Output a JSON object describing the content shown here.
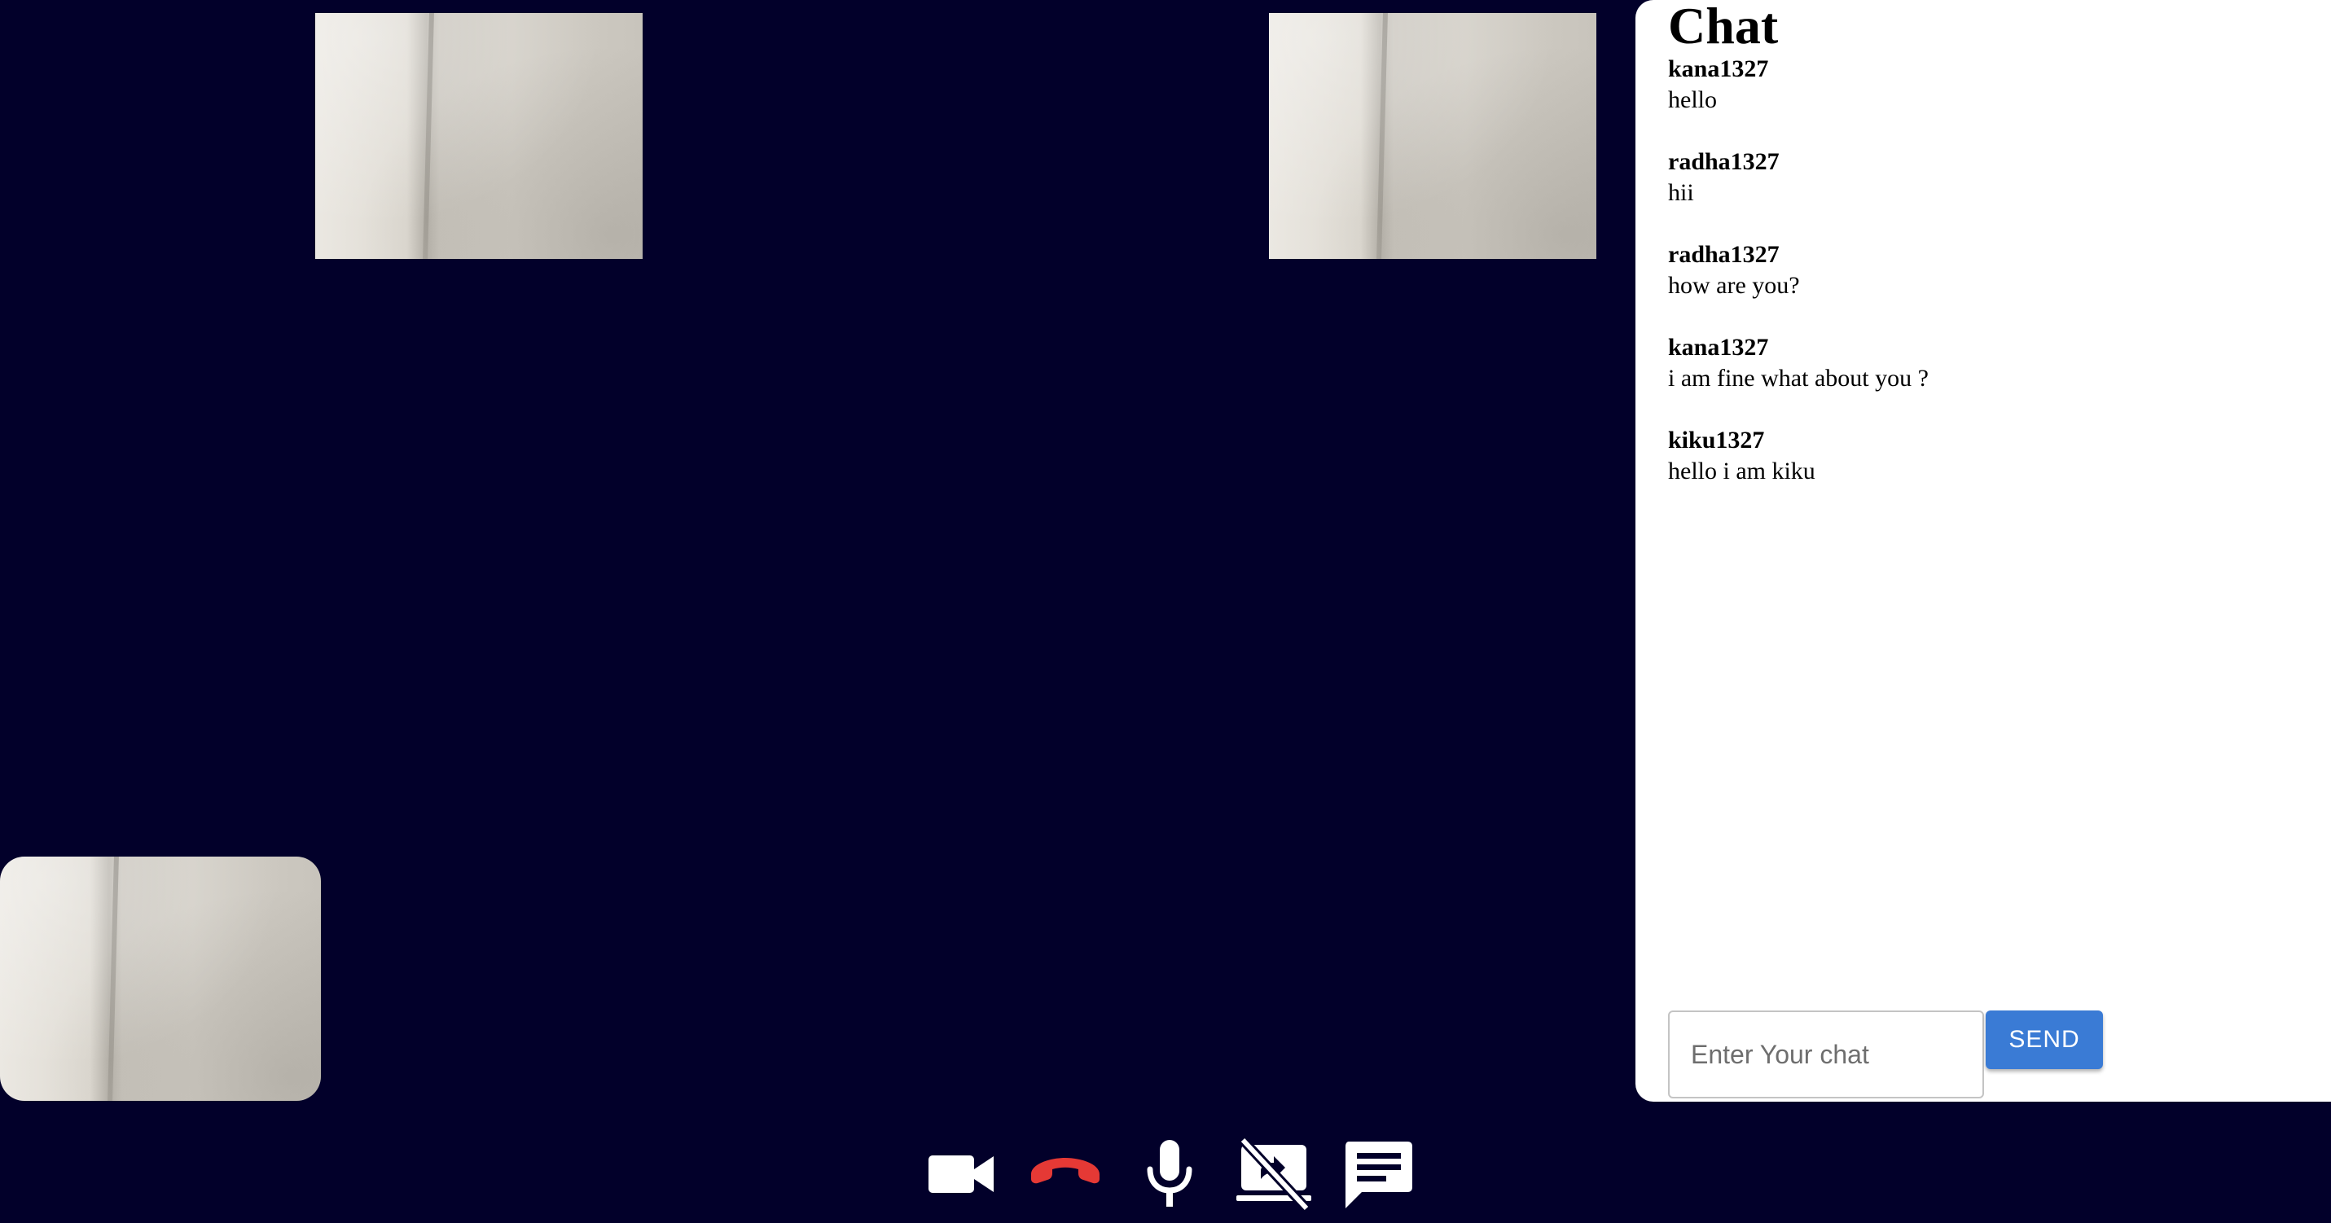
{
  "chat": {
    "title": "Chat",
    "messages": [
      {
        "user": "kana1327",
        "text": "hello"
      },
      {
        "user": "radha1327",
        "text": "hii"
      },
      {
        "user": "radha1327",
        "text": "how are you?"
      },
      {
        "user": "kana1327",
        "text": "i am fine what about you ?"
      },
      {
        "user": "kiku1327",
        "text": "hello i am kiku"
      }
    ],
    "input": {
      "placeholder": "Enter Your chat",
      "value": ""
    },
    "send_label": "SEND"
  },
  "controls": [
    {
      "icon": "video-camera-icon"
    },
    {
      "icon": "end-call-icon",
      "color": "#e53935"
    },
    {
      "icon": "microphone-icon"
    },
    {
      "icon": "screen-share-off-icon"
    },
    {
      "icon": "chat-icon"
    }
  ],
  "colors": {
    "background": "#02002a",
    "panel": "#ffffff",
    "send_button": "#3a7bd5",
    "end_call": "#e53935"
  }
}
